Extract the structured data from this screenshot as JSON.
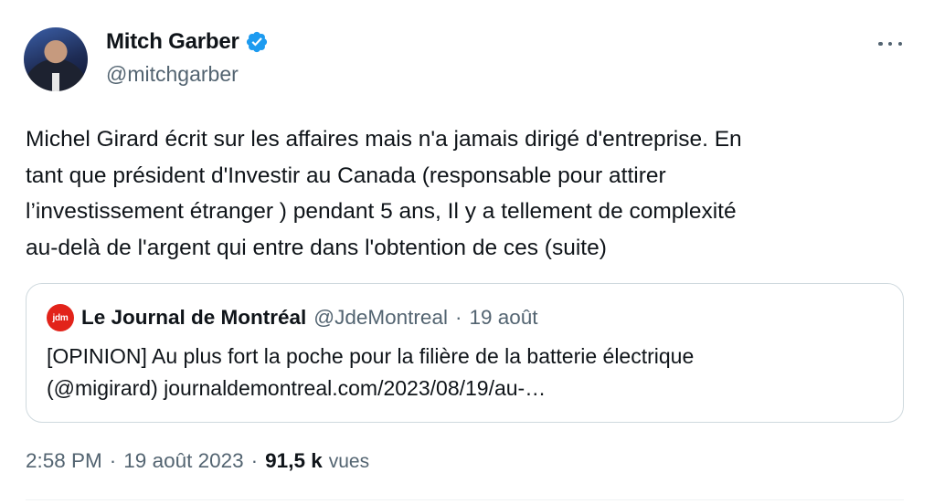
{
  "author": {
    "display_name": "Mitch Garber",
    "handle": "@mitchgarber"
  },
  "tweet": {
    "lines": [
      "Michel Girard écrit sur les affaires mais n'a jamais dirigé d'entreprise. En",
      "tant que président d'Investir au Canada (responsable pour attirer",
      "l’investissement étranger ) pendant 5 ans, Il y a tellement de complexité",
      "au-delà de l'argent qui entre dans l'obtention de ces (suite)"
    ]
  },
  "quote": {
    "logo_text": "jdm",
    "name": "Le Journal de Montréal",
    "handle": "@JdeMontreal",
    "separator": "·",
    "date": "19 août",
    "lines": [
      "[OPINION] Au plus fort la poche pour la filière de la batterie électrique",
      "(@migirard) journaldemontreal.com/2023/08/19/au-…"
    ]
  },
  "meta": {
    "time": "2:58 PM",
    "separator": "·",
    "date": "19 août 2023",
    "views_count": "91,5 k",
    "views_label": "vues"
  },
  "colors": {
    "verified": "#1d9bf0",
    "secondary_text": "#536471",
    "border": "#cfd9de",
    "jdm_red": "#e2231a"
  },
  "icons": {
    "verified": "verified-badge-icon",
    "more": "more-options-icon"
  }
}
